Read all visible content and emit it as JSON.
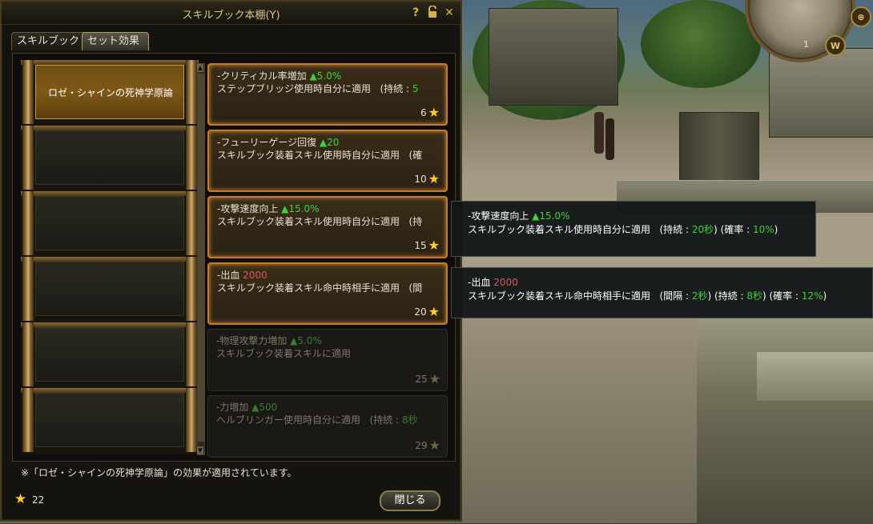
{
  "window": {
    "title": "スキルブック本棚(Y)",
    "help_label": "?",
    "lock_icon": "lock-icon",
    "close_label": "✕"
  },
  "tabs": [
    {
      "label": "スキルブック",
      "selected": false
    },
    {
      "label": "セット効果",
      "selected": true
    }
  ],
  "shelf": {
    "slots": [
      {
        "label": "ロゼ・シャインの死神学原論",
        "active": true
      },
      {
        "label": "",
        "active": false
      },
      {
        "label": "",
        "active": false
      },
      {
        "label": "",
        "active": false
      },
      {
        "label": "",
        "active": false
      },
      {
        "label": "",
        "active": false
      }
    ]
  },
  "effects": [
    {
      "name": "-クリティカル率増加",
      "value": "▲5.0%",
      "desc": "ステップブリッジ使用時自分に適用",
      "duration_label": "(持続 :",
      "duration_value": "5",
      "count": "6",
      "active": true
    },
    {
      "name": "-フューリーゲージ回復",
      "value": "▲20",
      "desc": "スキルブック装着スキル使用時自分に適用",
      "duration_label": "(確",
      "duration_value": "",
      "count": "10",
      "active": true
    },
    {
      "name": "-攻撃速度向上",
      "value": "▲15.0%",
      "desc": "スキルブック装着スキル使用時自分に適用",
      "duration_label": "(持",
      "duration_value": "",
      "count": "15",
      "active": true
    },
    {
      "name": "-出血",
      "value": "2000",
      "desc": "スキルブック装着スキル命中時相手に適用",
      "duration_label": "(間",
      "duration_value": "",
      "count": "20",
      "active": true
    },
    {
      "name": "-物理攻撃力増加",
      "value": "▲5.0%",
      "desc": "スキルブック装着スキルに適用",
      "duration_label": "",
      "duration_value": "",
      "count": "25",
      "active": false
    },
    {
      "name": "-力増加",
      "value": "▲500",
      "desc": "ヘルブリンガー使用時自分に適用",
      "duration_label": "(持続 :",
      "duration_value": "8秒",
      "count": "29",
      "active": false
    }
  ],
  "footer": {
    "note": "※「ロゼ・シャインの死神学原論」の効果が適用されています。",
    "star_count": "22",
    "close_button": "閉じる"
  },
  "tooltips": [
    {
      "name": "-攻撃速度向上",
      "value": "▲15.0%",
      "desc": "スキルブック装着スキル使用時自分に適用",
      "p1": "(持続 :",
      "v1": "20秒",
      "p2": ") (確率 :",
      "v2": "10%",
      "p3": ")"
    },
    {
      "name": "-出血",
      "value": "2000",
      "desc": "スキルブック装着スキル命中時相手に適用",
      "p1": "(間隔 :",
      "v1": "2秒",
      "p2": ") (持続 :",
      "v2": "8秒",
      "p3": ") (確率 :",
      "v3": "12%",
      "p4": ")"
    }
  ],
  "minimap": {
    "number": "1",
    "w_button": "W"
  },
  "colors": {
    "accent_gold": "#d8c68c",
    "active_border": "#c27a2c",
    "positive": "#3ed13a",
    "bleed": "#d85858",
    "star": "#ffcc2e"
  }
}
